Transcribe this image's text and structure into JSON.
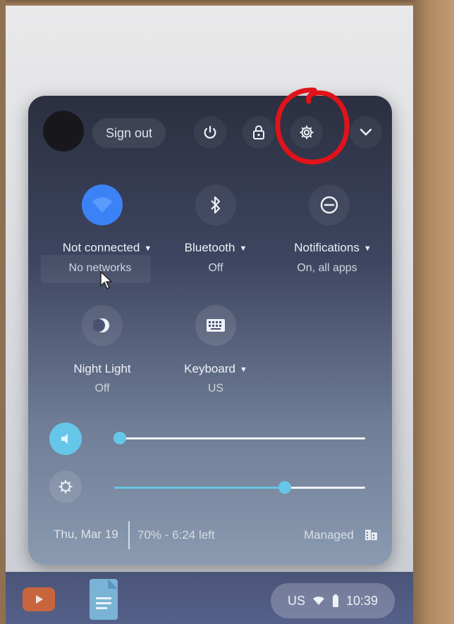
{
  "header": {
    "signout_label": "Sign out",
    "buttons": [
      {
        "name": "power-icon"
      },
      {
        "name": "lock-icon"
      },
      {
        "name": "gear-icon"
      },
      {
        "name": "chevron-down-icon"
      }
    ]
  },
  "tiles": {
    "network": {
      "label": "Not connected",
      "sub": "No networks"
    },
    "bluetooth": {
      "label": "Bluetooth",
      "sub": "Off"
    },
    "notifications": {
      "label": "Notifications",
      "sub": "On, all apps"
    },
    "night_light": {
      "label": "Night Light",
      "sub": "Off"
    },
    "keyboard": {
      "label": "Keyboard",
      "sub": "US"
    }
  },
  "sliders": {
    "volume_level": 0.0,
    "brightness_level": 0.68
  },
  "footer": {
    "date": "Thu, Mar 19",
    "battery": "70% - 6:24 left",
    "managed": "Managed"
  },
  "shelf": {
    "input_method": "US",
    "time": "10:39"
  },
  "colors": {
    "accent": "#66c6e8",
    "wifi_active": "#3b82f6",
    "annotation": "#e0131b"
  }
}
